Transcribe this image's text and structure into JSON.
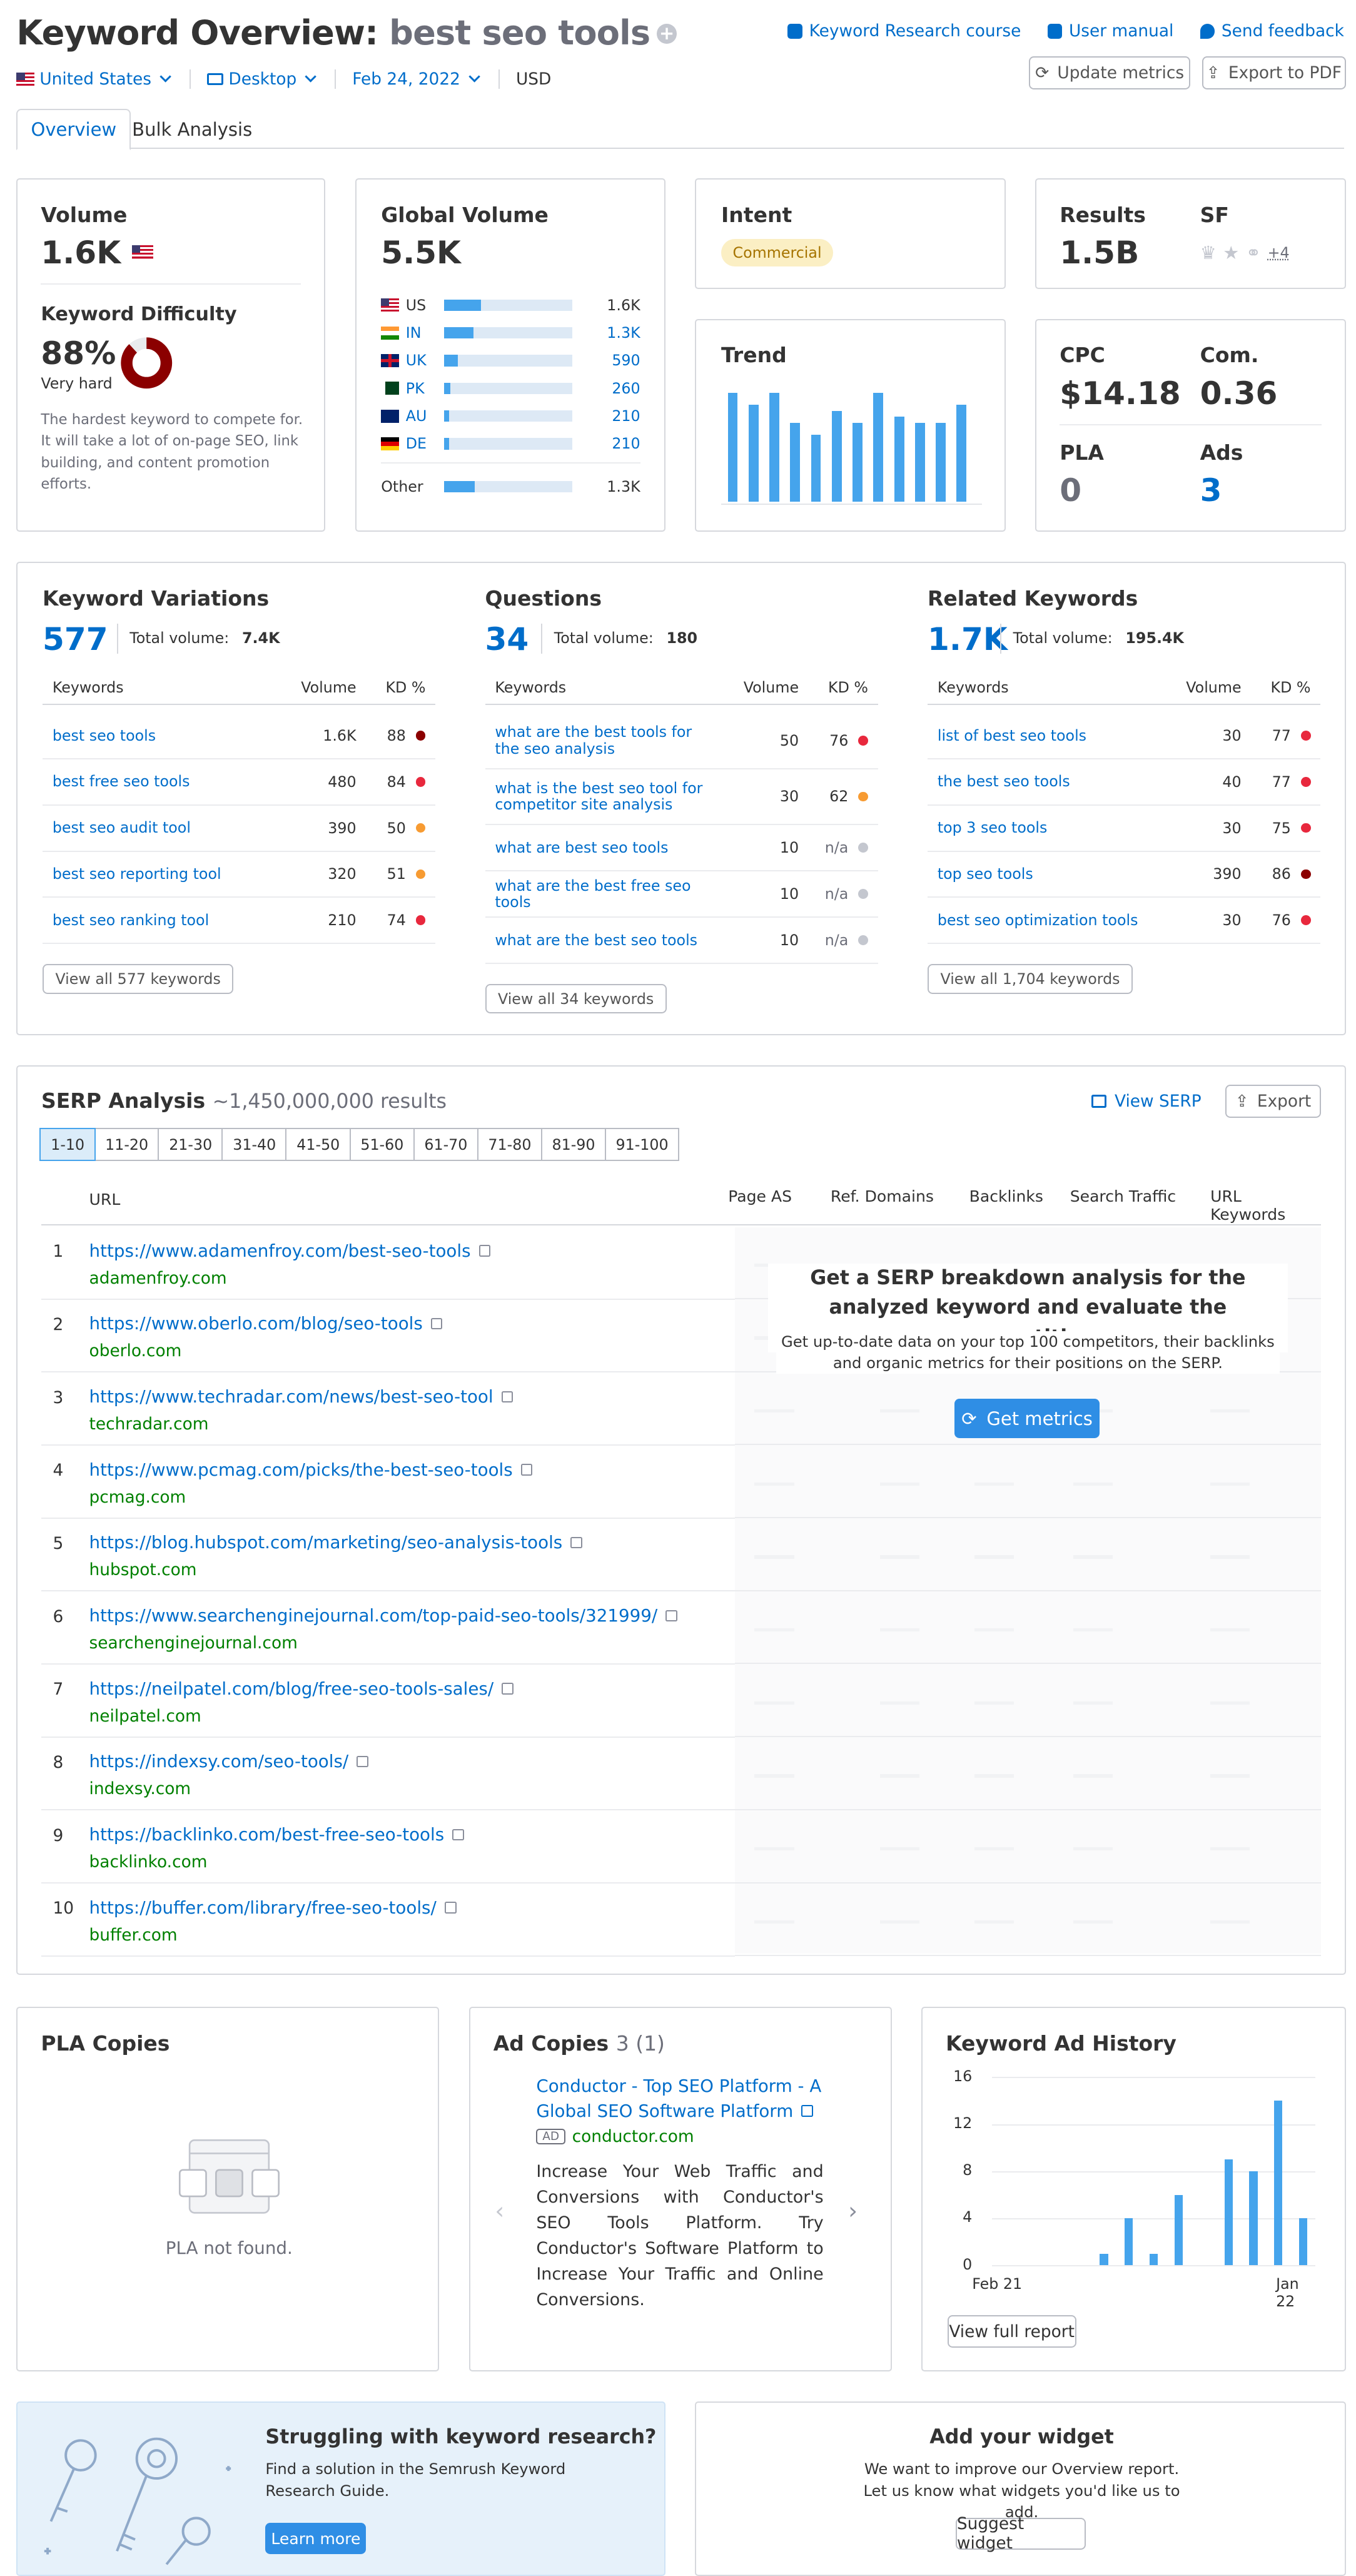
{
  "header": {
    "title_prefix": "Keyword Overview:",
    "keyword": "best seo tools",
    "links": [
      "Keyword Research course",
      "User manual",
      "Send feedback"
    ],
    "database": "United States",
    "device": "Desktop",
    "date": "Feb 24, 2022",
    "currency": "USD",
    "update_btn": "Update metrics",
    "export_btn": "Export to PDF"
  },
  "tabs": [
    "Overview",
    "Bulk Analysis"
  ],
  "volume": {
    "label": "Volume",
    "value": "1.6K"
  },
  "kd": {
    "label": "Keyword Difficulty",
    "value": "88%",
    "level": "Very hard",
    "percent": 88,
    "desc": "The hardest keyword to compete for. It will take a lot of on-page SEO, link building, and content promotion efforts.",
    "color": "#8b0000"
  },
  "global": {
    "label": "Global Volume",
    "value": "5.5K",
    "rows": [
      {
        "cc": "US",
        "v": "1.6K",
        "pct": 29
      },
      {
        "cc": "IN",
        "v": "1.3K",
        "pct": 23
      },
      {
        "cc": "UK",
        "v": "590",
        "pct": 11
      },
      {
        "cc": "PK",
        "v": "260",
        "pct": 5
      },
      {
        "cc": "AU",
        "v": "210",
        "pct": 4
      },
      {
        "cc": "DE",
        "v": "210",
        "pct": 4
      }
    ],
    "other": {
      "cc": "Other",
      "v": "1.3K",
      "pct": 24
    }
  },
  "intent": {
    "label": "Intent",
    "value": "Commercial"
  },
  "results": {
    "label": "Results",
    "value": "1.5B",
    "sf_label": "SF",
    "sf_more": "+4"
  },
  "trend": {
    "label": "Trend",
    "values": [
      90,
      80,
      90,
      65,
      55,
      75,
      65,
      90,
      70,
      65,
      65,
      80
    ]
  },
  "cpc": {
    "cpc_label": "CPC",
    "cpc": "$14.18",
    "com_label": "Com.",
    "com": "0.36",
    "pla_label": "PLA",
    "pla": "0",
    "ads_label": "Ads",
    "ads": "3"
  },
  "variations": {
    "title": "Keyword Variations",
    "count": "577",
    "total_label": "Total volume:",
    "total": "7.4K",
    "cols": [
      "Keywords",
      "Volume",
      "KD %"
    ],
    "rows": [
      {
        "k": "best seo tools",
        "v": "1.6K",
        "kd": "88",
        "c": "#8b0000"
      },
      {
        "k": "best free seo tools",
        "v": "480",
        "kd": "84",
        "c": "#e8283d"
      },
      {
        "k": "best seo audit tool",
        "v": "390",
        "kd": "50",
        "c": "#f79b32"
      },
      {
        "k": "best seo reporting tool",
        "v": "320",
        "kd": "51",
        "c": "#f79b32"
      },
      {
        "k": "best seo ranking tool",
        "v": "210",
        "kd": "74",
        "c": "#e8283d"
      }
    ],
    "btn": "View all 577 keywords"
  },
  "questions": {
    "title": "Questions",
    "count": "34",
    "total_label": "Total volume:",
    "total": "180",
    "cols": [
      "Keywords",
      "Volume",
      "KD %"
    ],
    "rows": [
      {
        "k": "what are the best tools for the seo analysis",
        "v": "50",
        "kd": "76",
        "c": "#e8283d"
      },
      {
        "k": "what is the best seo tool for competitor site analysis",
        "v": "30",
        "kd": "62",
        "c": "#f79b32"
      },
      {
        "k": "what are best seo tools",
        "v": "10",
        "kd": "n/a",
        "c": "#c4c7cf"
      },
      {
        "k": "what are the best free seo tools",
        "v": "10",
        "kd": "n/a",
        "c": "#c4c7cf"
      },
      {
        "k": "what are the best seo tools",
        "v": "10",
        "kd": "n/a",
        "c": "#c4c7cf"
      }
    ],
    "btn": "View all 34 keywords"
  },
  "related": {
    "title": "Related Keywords",
    "count": "1.7K",
    "total_label": "Total volume:",
    "total": "195.4K",
    "cols": [
      "Keywords",
      "Volume",
      "KD %"
    ],
    "rows": [
      {
        "k": "list of best seo tools",
        "v": "30",
        "kd": "77",
        "c": "#e8283d"
      },
      {
        "k": "the best seo tools",
        "v": "40",
        "kd": "77",
        "c": "#e8283d"
      },
      {
        "k": "top 3 seo tools",
        "v": "30",
        "kd": "75",
        "c": "#e8283d"
      },
      {
        "k": "top seo tools",
        "v": "390",
        "kd": "86",
        "c": "#8b0000"
      },
      {
        "k": "best seo optimization tools",
        "v": "30",
        "kd": "76",
        "c": "#e8283d"
      }
    ],
    "btn": "View all 1,704 keywords"
  },
  "serp": {
    "title": "SERP Analysis",
    "results": "~1,450,000,000 results",
    "view": "View SERP",
    "export": "Export",
    "pages": [
      "1-10",
      "11-20",
      "21-30",
      "31-40",
      "41-50",
      "51-60",
      "61-70",
      "71-80",
      "81-90",
      "91-100"
    ],
    "cols": [
      "URL",
      "Page AS",
      "Ref. Domains",
      "Backlinks",
      "Search Traffic",
      "URL Keywords"
    ],
    "rows": [
      {
        "url": "https://www.adamenfroy.com/best-seo-tools",
        "domain": "adamenfroy.com"
      },
      {
        "url": "https://www.oberlo.com/blog/seo-tools",
        "domain": "oberlo.com"
      },
      {
        "url": "https://www.techradar.com/news/best-seo-tool",
        "domain": "techradar.com"
      },
      {
        "url": "https://www.pcmag.com/picks/the-best-seo-tools",
        "domain": "pcmag.com"
      },
      {
        "url": "https://blog.hubspot.com/marketing/seo-analysis-tools",
        "domain": "hubspot.com"
      },
      {
        "url": "https://www.searchenginejournal.com/top-paid-seo-tools/321999/",
        "domain": "searchenginejournal.com"
      },
      {
        "url": "https://neilpatel.com/blog/free-seo-tools-sales/",
        "domain": "neilpatel.com"
      },
      {
        "url": "https://indexsy.com/seo-tools/",
        "domain": "indexsy.com"
      },
      {
        "url": "https://backlinko.com/best-free-seo-tools",
        "domain": "backlinko.com"
      },
      {
        "url": "https://buffer.com/library/free-seo-tools/",
        "domain": "buffer.com"
      }
    ],
    "overlay_title": "Get a SERP breakdown analysis for the analyzed keyword and evaluate the competition",
    "overlay_text": "Get up-to-date data on your top 100 competitors, their backlinks and organic metrics for their positions on the SERP.",
    "overlay_btn": "Get metrics"
  },
  "pla": {
    "title": "PLA Copies",
    "empty": "PLA not found."
  },
  "ads": {
    "title": "Ad Copies",
    "count": "3 (1)",
    "ad_title": "Conductor - Top SEO Platform - A Global SEO Software Platform",
    "badge": "AD",
    "domain": "conductor.com",
    "text": "Increase Your Web Traffic and Conversions with Conductor's SEO Tools Platform. Try Conductor's Software Platform to Increase Your Traffic and Online Conversions."
  },
  "history": {
    "title": "Keyword Ad History",
    "yticks": [
      "16",
      "12",
      "8",
      "4",
      "0"
    ],
    "xstart": "Feb 21",
    "xend": "Jan 22",
    "values": [
      0,
      0,
      0,
      0,
      1,
      4,
      1,
      6,
      0,
      9,
      8,
      14,
      4
    ],
    "ymax": 16,
    "btn": "View full report"
  },
  "promo": {
    "title": "Struggling with keyword research?",
    "text": "Find a solution in the Semrush Keyword Research Guide.",
    "btn": "Learn more"
  },
  "widget": {
    "title": "Add your widget",
    "text": "We want to improve our Overview report. Let us know what widgets you'd like us to add.",
    "btn": "Suggest widget"
  }
}
